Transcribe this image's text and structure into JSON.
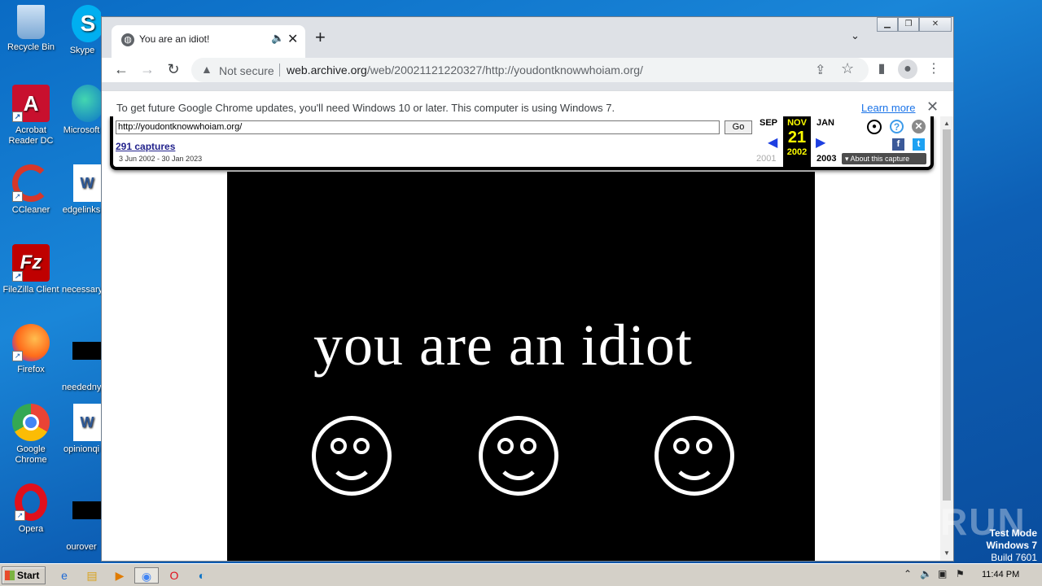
{
  "desktop": {
    "icons": [
      {
        "label": "Recycle Bin",
        "glyph": "🗑"
      },
      {
        "label": "Acrobat Reader DC",
        "glyph": "A"
      },
      {
        "label": "CCleaner",
        "glyph": "C"
      },
      {
        "label": "FileZilla Client",
        "glyph": "FZ"
      },
      {
        "label": "Firefox",
        "glyph": "🦊"
      },
      {
        "label": "Google Chrome",
        "glyph": "◉"
      },
      {
        "label": "Opera",
        "glyph": "O"
      }
    ],
    "icons_col2": [
      {
        "label": "Skype"
      },
      {
        "label": "Microsoft"
      },
      {
        "label": "edgelinks"
      },
      {
        "label": "necessary"
      },
      {
        "label": "neededny"
      },
      {
        "label": "opinionqi"
      },
      {
        "label": "ourover"
      }
    ]
  },
  "browser": {
    "tab_title": "You are an idiot!",
    "address_security": "Not secure",
    "address_host": "web.archive.org",
    "address_path": "/web/20021121220327/http://youdontknowwhoiam.org/",
    "infobar_message": "To get future Google Chrome updates, you'll need Windows 10 or later. This computer is using Windows 7.",
    "infobar_link": "Learn more"
  },
  "wayback": {
    "url_value": "http://youdontknowwhoiam.org/",
    "go_label": "Go",
    "captures": "291 captures",
    "range": "3 Jun 2002 - 30 Jan 2023",
    "prev_month": "SEP",
    "prev_year": "2001",
    "cur_month": "NOV",
    "cur_day": "21",
    "cur_year": "2002",
    "next_month": "JAN",
    "next_year": "2003",
    "about": "About this capture"
  },
  "page": {
    "headline": "you are an idiot"
  },
  "taskbar": {
    "start_label": "Start",
    "clock": "11:44 PM"
  },
  "overlay": {
    "watermark": "ANY RUN",
    "test_mode": "Test Mode",
    "os_name": "Windows 7",
    "build": "Build 7601"
  },
  "colors": {
    "wayback_highlight": "#ffff00",
    "wayback_arrow": "#1d3fe1",
    "link_blue": "#1a73e8"
  }
}
